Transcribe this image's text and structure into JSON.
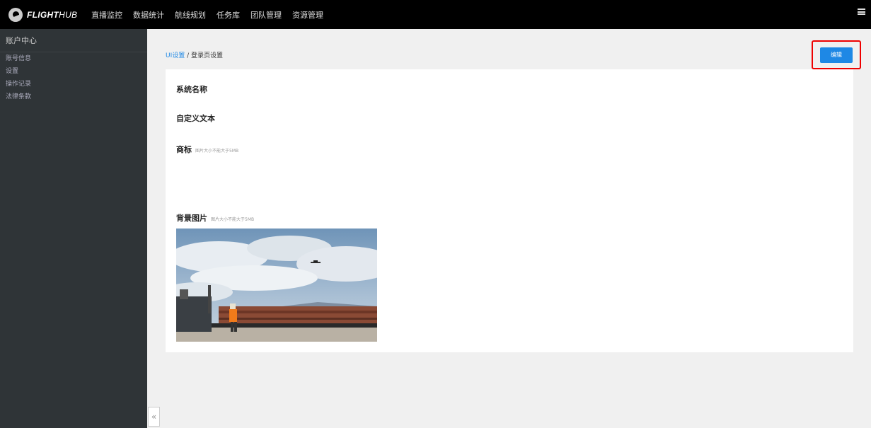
{
  "brand": {
    "primary": "FLIGHT",
    "secondary": "HUB"
  },
  "nav": [
    "直播监控",
    "数据统计",
    "航线规划",
    "任务库",
    "团队管理",
    "资源管理"
  ],
  "sidebar": {
    "title": "账户中心",
    "items": [
      "账号信息",
      "设置",
      "操作记录",
      "法律条款"
    ]
  },
  "breadcrumb": {
    "link": "UI设置",
    "separator": " / ",
    "current": "登录页设置"
  },
  "toolbar": {
    "edit_label": "编辑"
  },
  "fields": {
    "system_name": "系统名称",
    "custom_text": "自定义文本",
    "logo_label": "商标",
    "logo_hint": "图片大小不能大于5MB",
    "bg_label": "背景图片",
    "bg_hint": "图片大小不能大于5MB"
  },
  "collapse_glyph": "«",
  "colors": {
    "accent": "#1e88e5",
    "highlight": "#e00000",
    "topbar": "#000000",
    "sidebar": "#2f3437"
  }
}
